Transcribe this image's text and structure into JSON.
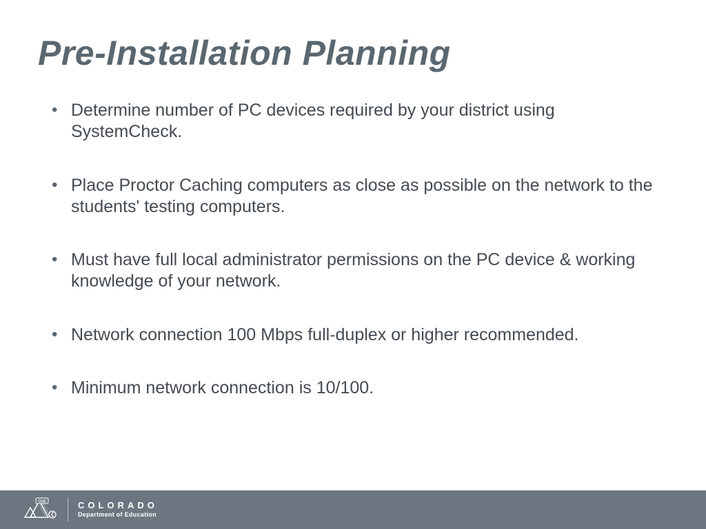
{
  "slide": {
    "title": "Pre-Installation Planning",
    "bullets": [
      "Determine number of PC devices required by your district using SystemCheck.",
      "Place Proctor Caching computers as close as possible on the network to the students' testing computers.",
      "Must have full local administrator permissions on the PC device & working knowledge of your network.",
      "Network connection 100 Mbps full-duplex or higher recommended.",
      "Minimum network connection is 10/100."
    ]
  },
  "footer": {
    "logo_label": "CDE",
    "brand_main": "COLORADO",
    "brand_sub": "Department of Education"
  },
  "colors": {
    "text": "#5b6770",
    "footer_bg": "#6b7680",
    "footer_text": "#ffffff"
  }
}
